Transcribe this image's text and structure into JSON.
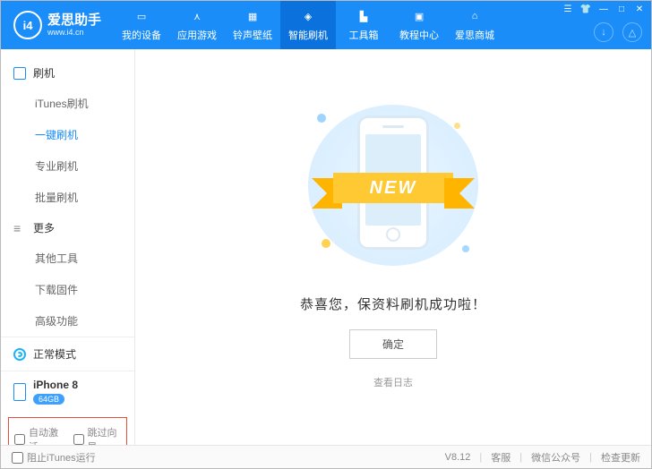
{
  "logo": {
    "badge": "i4",
    "title": "爱思助手",
    "url": "www.i4.cn"
  },
  "topnav": [
    {
      "label": "我的设备",
      "icon": "phone"
    },
    {
      "label": "应用游戏",
      "icon": "apps"
    },
    {
      "label": "铃声壁纸",
      "icon": "media"
    },
    {
      "label": "智能刷机",
      "icon": "flash",
      "active": true
    },
    {
      "label": "工具箱",
      "icon": "toolbox"
    },
    {
      "label": "教程中心",
      "icon": "tutorial"
    },
    {
      "label": "爱思商城",
      "icon": "shop"
    }
  ],
  "sidebar": {
    "group1": "刷机",
    "items1": [
      "iTunes刷机",
      "一键刷机",
      "专业刷机",
      "批量刷机"
    ],
    "active1": 1,
    "group2": "更多",
    "items2": [
      "其他工具",
      "下载固件",
      "高级功能"
    ],
    "status": "正常模式",
    "device": {
      "name": "iPhone 8",
      "storage": "64GB"
    },
    "checks": {
      "auto": "自动激活",
      "skip": "跳过向导"
    }
  },
  "main": {
    "ribbon": "NEW",
    "message": "恭喜您，保资料刷机成功啦！",
    "ok": "确定",
    "log": "查看日志"
  },
  "footer": {
    "block": "阻止iTunes运行",
    "version": "V8.12",
    "support": "客服",
    "wechat": "微信公众号",
    "update": "检查更新"
  }
}
